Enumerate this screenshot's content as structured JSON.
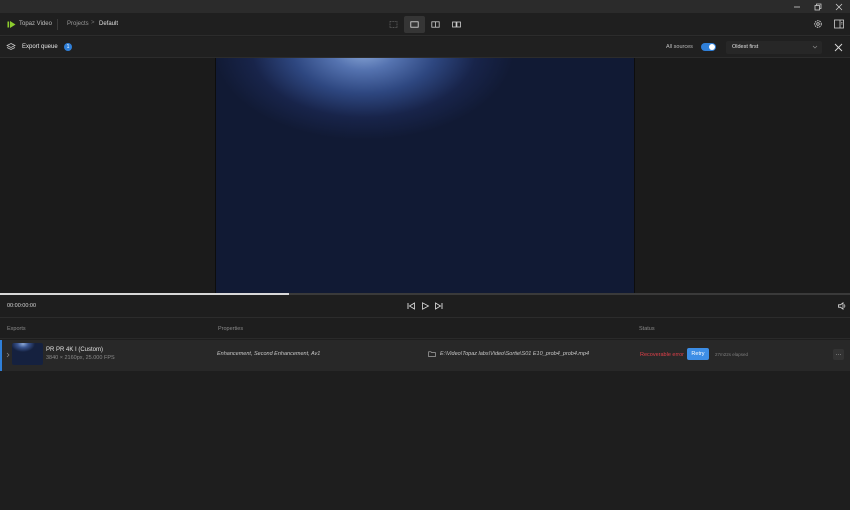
{
  "app": {
    "name": "Topaz Video"
  },
  "breadcrumb": {
    "projects": "Projects",
    "separator": ">",
    "current": "Default"
  },
  "view_modes": [
    "single-view-icon",
    "preview-view-icon",
    "side-by-side-icon",
    "compare-view-icon"
  ],
  "queue": {
    "title": "Export queue",
    "badge": "1",
    "all_sources_label": "All sources",
    "all_sources_enabled": true,
    "sort_value": "Oldest first"
  },
  "player": {
    "timecode": "00:00:00:00",
    "progress": 0.34
  },
  "table": {
    "headers": {
      "exports": "Exports",
      "properties": "Properties",
      "status": "Status"
    },
    "rows": [
      {
        "name": "PR PR 4K I (Custom)",
        "meta": "3840 × 2160px, 25.000 FPS",
        "properties": "Enhancement, Second Enhancement, Av1",
        "path": "E:\\Video\\Topaz labs\\Video\\Sortie\\S01 E10_prob4_prob4.mp4",
        "status": "Recoverable error",
        "retry_label": "Retry",
        "elapsed": "27m22s elapsed",
        "more": "···"
      }
    ]
  },
  "colors": {
    "accent": "#2f7fd8",
    "error": "#e0404a",
    "logo": "#8ccc2e"
  }
}
